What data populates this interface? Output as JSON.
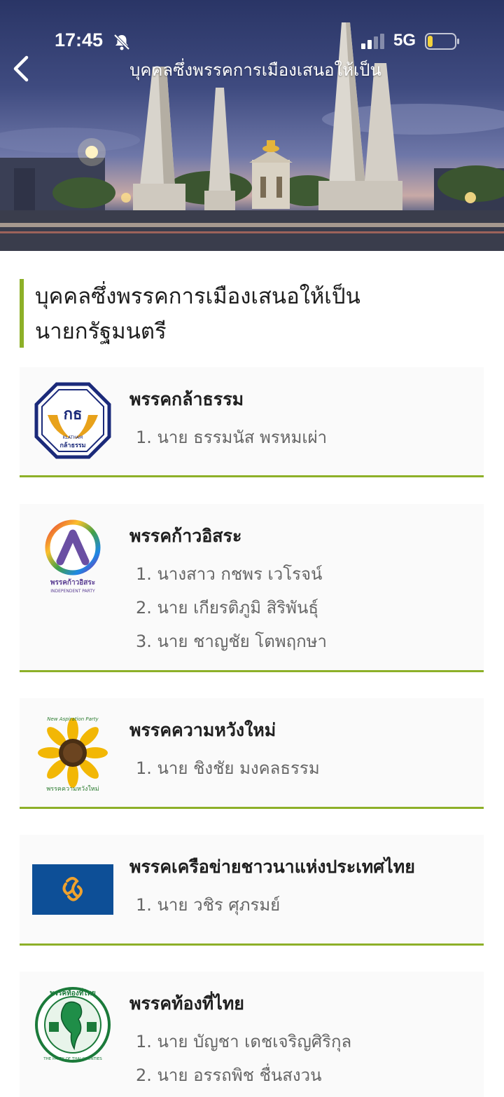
{
  "status_bar": {
    "time": "17:45",
    "network": "5G",
    "icons": [
      "bell-off-icon",
      "signal-icon",
      "battery-icon"
    ]
  },
  "header": {
    "title": "บุคคลซึ่งพรรคการเมืองเสนอให้เป็น",
    "back_icon": "chevron-left-icon"
  },
  "section": {
    "title_line1": "บุคคลซึ่งพรรคการเมืองเสนอให้เป็น",
    "title_line2": "นายกรัฐมนตรี",
    "accent_color": "#8db028"
  },
  "parties": [
    {
      "name": "พรรคกล้าธรรม",
      "logo": "klatham-logo",
      "logo_text": [
        "กธ",
        "KLATHAM",
        "กล้าธรรม"
      ],
      "candidates": [
        "1. นาย ธรรมนัส พรหมเผ่า"
      ]
    },
    {
      "name": "พรรคก้าวอิสระ",
      "logo": "independent-party-logo",
      "logo_text": [
        "พรรคก้าวอิสระ",
        "INDEPENDENT PARTY"
      ],
      "candidates": [
        "1. นางสาว กชพร เวโรจน์",
        "2. นาย เกียรติภูมิ สิริพันธุ์",
        "3. นาย ชาญชัย โตพฤกษา"
      ]
    },
    {
      "name": "พรรคความหวังใหม่",
      "logo": "new-aspiration-party-logo",
      "logo_text": [
        "New Aspiration Party",
        "พรรคความหวังใหม่"
      ],
      "candidates": [
        "1. นาย ชิงชัย มงคลธรรม"
      ]
    },
    {
      "name": "พรรคเครือข่ายชาวนาแห่งประเทศไทย",
      "logo": "farmers-network-logo",
      "candidates": [
        "1. นาย วชิร ศุภรมย์"
      ]
    },
    {
      "name": "พรรคท้องที่ไทย",
      "logo": "thai-counties-party-logo",
      "logo_text": [
        "พรรคท้องที่ไทย",
        "THE PARTY OF THAI COUNTIES"
      ],
      "candidates": [
        "1. นาย บัญชา เดชเจริญศิริกุล",
        "2. นาย อรรถพิช ชื่นสงวน"
      ]
    }
  ]
}
